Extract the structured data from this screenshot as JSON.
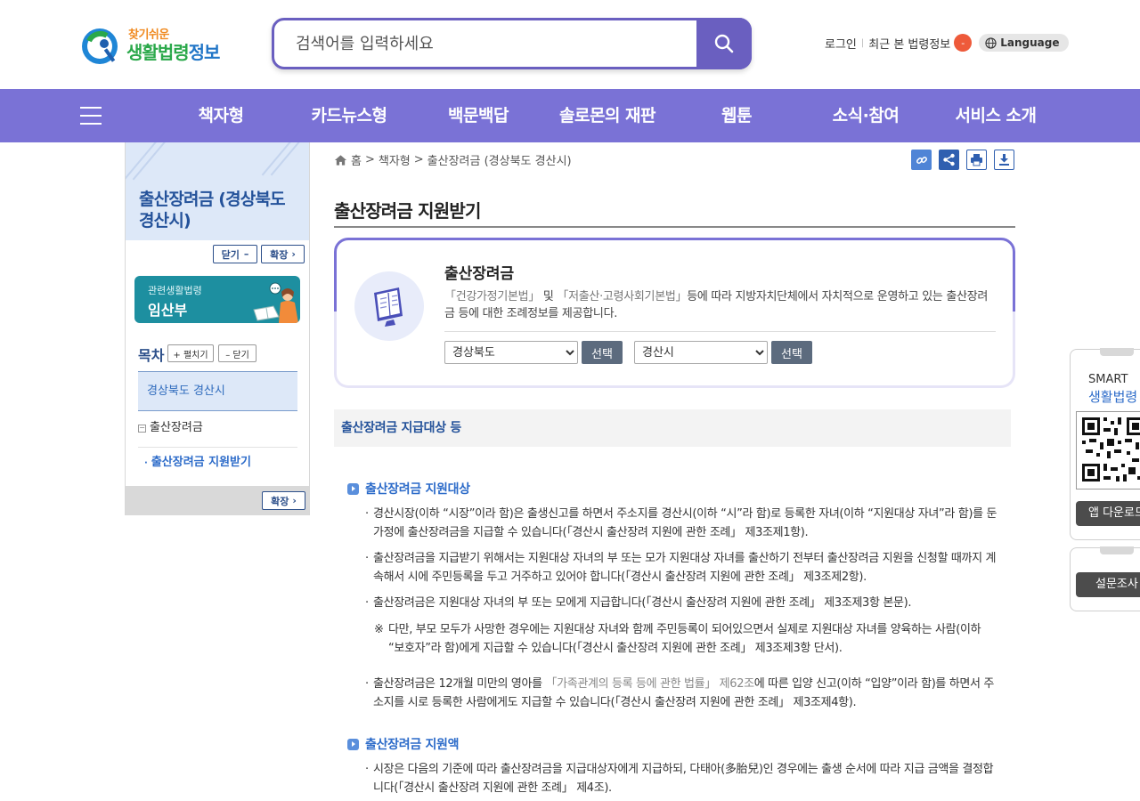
{
  "header": {
    "logo_sub": "찾기쉬운",
    "logo_main_a": "생활",
    "logo_main_b": "법령",
    "logo_main_c": "정보",
    "search_placeholder": "검색어를 입력하세요",
    "login": "로그인",
    "recent": "최근 본 법령정보",
    "recent_count": "-",
    "language": "Language"
  },
  "gnb": {
    "items": [
      "책자형",
      "카드뉴스형",
      "백문백답",
      "솔로몬의 재판",
      "웹툰",
      "소식·참여",
      "서비스 소개"
    ]
  },
  "sidebar": {
    "title": "출산장려금 (경상북도 경산시)",
    "close_label": "닫기",
    "expand_label": "확장",
    "related_sub": "관련생활법령",
    "related_main": "임산부",
    "toc_label": "목차",
    "toc_open": "+ 펼치기",
    "toc_close": "– 닫기",
    "toc_items": [
      "경상북도 경산시",
      "출산장려금",
      "출산장려금 지원받기"
    ],
    "footer_expand": "확장"
  },
  "breadcrumb": {
    "home": "홈",
    "level1": "책자형",
    "level2": "출산장려금 (경상북도 경산시)"
  },
  "page_title": "출산장려금 지원받기",
  "intro": {
    "title": "출산장려금",
    "desc_law1": "「건강가정기본법」",
    "desc_mid": "및",
    "desc_law2": "「저출산·고령사회기본법」",
    "desc_rest": "등에 따라 지방자치단체에서 자치적으로 운영하고 있는 출산장려금 등에 대한 조례정보를 제공합니다.",
    "select1_value": "경상북도",
    "select2_value": "경산시",
    "select_btn": "선택"
  },
  "section": {
    "heading": "출산장려금 지급대상 등",
    "sub1": "출산장려금 지원대상",
    "p1": "경산시장(이하 “시장”이라 함)은 출생신고를 하면서 주소지를 경산시(이하 “시”라 함)로 등록한 자녀(이하 “지원대상 자녀”라 함)를 둔 가정에 출산장려금을 지급할 수 있습니다(「경산시 출산장려 지원에 관한 조례」 제3조제1항).",
    "p2": "출산장려금을 지급받기 위해서는 지원대상 자녀의 부 또는 모가 지원대상 자녀를 출산하기 전부터 출산장려금 지원을 신청할 때까지 계속해서 시에 주민등록을 두고 거주하고 있어야 합니다(「경산시 출산장려 지원에 관한 조례」 제3조제2항).",
    "p3": "출산장려금은 지원대상 자녀의 부 또는 모에게 지급합니다(「경산시 출산장려 지원에 관한 조례」 제3조제3항 본문).",
    "note_mark": "※",
    "note": "다만, 부모 모두가 사망한 경우에는 지원대상 자녀와 함께 주민등록이 되어있으면서 실제로 지원대상 자녀를 양육하는 사람(이하 “보호자”라 함)에게 지급할 수 있습니다(「경산시 출산장려 지원에 관한 조례」 제3조제3항 단서).",
    "p4_a": "출산장려금은 12개월 미만의 영아를",
    "p4_law": "「가족관계의 등록 등에 관한 법률」 제62조",
    "p4_b": "에 따른 입양 신고(이하 “입양”이라 함)를 하면서 주소지를 시로 등록한 사람에게도 지급할 수 있습니다(「경산시 출산장려 지원에 관한 조례」 제3조제4항).",
    "sub2": "출산장려금 지원액",
    "p5": "시장은 다음의 기준에 따라 출산장려금을 지급대상자에게 지급하되, 다태아(多胎兒)인 경우에는 출생 순서에 따라 지급 금액을 결정합니다(「경산시 출산장려 지원에 관한 조례」 제4조)."
  },
  "floating": {
    "smart_line1": "SMART",
    "smart_line2": "생활법령",
    "app_download": "앱 다운로드",
    "survey": "설문조사"
  }
}
